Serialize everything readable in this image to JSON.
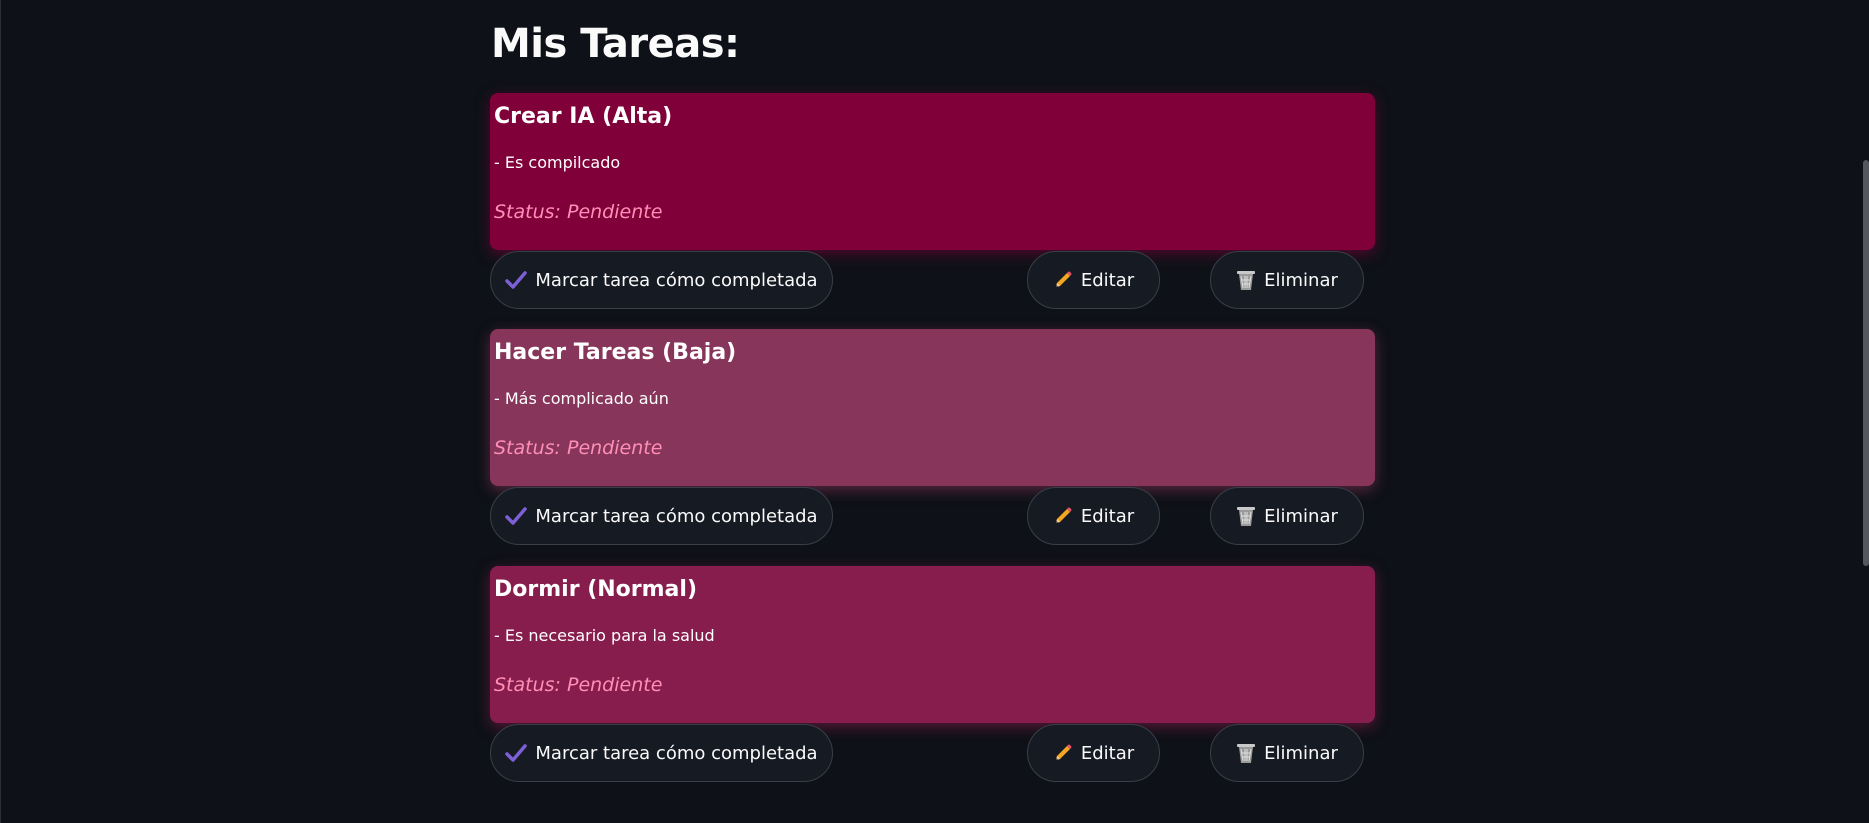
{
  "header": {
    "title": "Mis Tareas:"
  },
  "colors": {
    "background": "#0e1117",
    "priority_alta": "#80003a",
    "priority_baja": "#87355a",
    "priority_normal": "#871d4c",
    "status_text": "#ff8fb6",
    "check_icon": "#7d5fd6"
  },
  "actions": {
    "complete_label": "Marcar tarea cómo completada",
    "edit_label": "Editar",
    "delete_label": "Eliminar"
  },
  "tasks": [
    {
      "title": "Crear IA (Alta)",
      "description": "- Es compilcado",
      "status": "Status: Pendiente",
      "color": "#80003a"
    },
    {
      "title": "Hacer Tareas (Baja)",
      "description": "- Más complicado aún",
      "status": "Status: Pendiente",
      "color": "#87355a"
    },
    {
      "title": "Dormir (Normal)",
      "description": "- Es necesario para la salud",
      "status": "Status: Pendiente",
      "color": "#871d4c"
    }
  ],
  "icons": {
    "complete": "check-icon",
    "edit": "pencil-icon",
    "delete": "wastebasket-icon"
  }
}
